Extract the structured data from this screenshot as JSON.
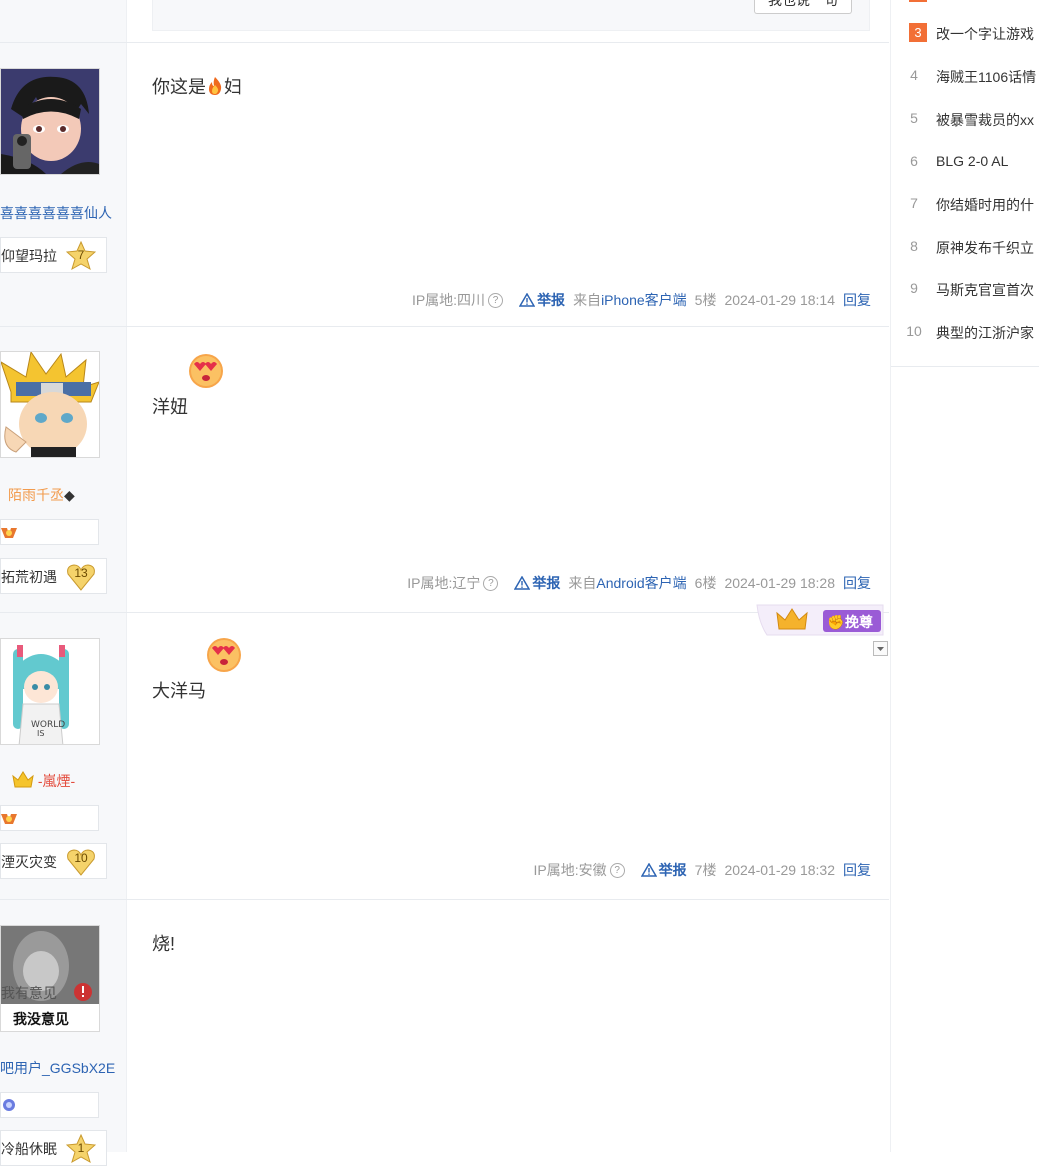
{
  "top_reply_button": "我也说一句",
  "hot_list": [
    {
      "rank": "3",
      "title": "改一个字让游戏",
      "highlight": true
    },
    {
      "rank": "4",
      "title": "海贼王1106话情",
      "highlight": false
    },
    {
      "rank": "5",
      "title": "被暴雪裁员的xx",
      "highlight": false
    },
    {
      "rank": "6",
      "title": "BLG 2-0 AL",
      "highlight": false
    },
    {
      "rank": "7",
      "title": "你结婚时用的什",
      "highlight": false
    },
    {
      "rank": "8",
      "title": "原神发布千织立",
      "highlight": false
    },
    {
      "rank": "9",
      "title": "马斯克官宣首次",
      "highlight": false
    },
    {
      "rank": "10",
      "title": "典型的江浙沪家",
      "highlight": false
    }
  ],
  "posts": [
    {
      "username": "喜喜喜喜喜喜仙人",
      "level_name": "仰望玛拉",
      "level": "7",
      "content": "你这是",
      "content_suffix": "妇",
      "ip": "IP属地:四川",
      "report": "举报",
      "source_prefix": "来自",
      "source": "iPhone客户端",
      "floor": "5楼",
      "time": "2024-01-29 18:14",
      "reply": "回复"
    },
    {
      "username": "陌雨千丞",
      "username_suffix": "◆",
      "level_name": "拓荒初遇",
      "level": "13",
      "content": "洋妞",
      "ip": "IP属地:辽宁",
      "report": "举报",
      "source_prefix": "来自",
      "source": "Android客户端",
      "floor": "6楼",
      "time": "2024-01-29 18:28",
      "reply": "回复"
    },
    {
      "username": "-嵐煙-",
      "level_name": "湮灭灾变",
      "level": "10",
      "content": "大洋马",
      "ip": "IP属地:安徽",
      "report": "举报",
      "floor": "7楼",
      "time": "2024-01-29 18:32",
      "reply": "回复",
      "crown_badge": "挽尊"
    },
    {
      "username": "吧用户_GGSbX2E",
      "level_name": "冷船休眠",
      "level": "1",
      "content": "烧!",
      "avatar_text_top": "我有意见",
      "avatar_text_bottom": "我没意见"
    }
  ],
  "colors": {
    "link_blue": "#2d64b3",
    "hot_rank_orange": "#f26f36",
    "username_orange": "#f29b4d",
    "username_red": "#e34b3c"
  }
}
